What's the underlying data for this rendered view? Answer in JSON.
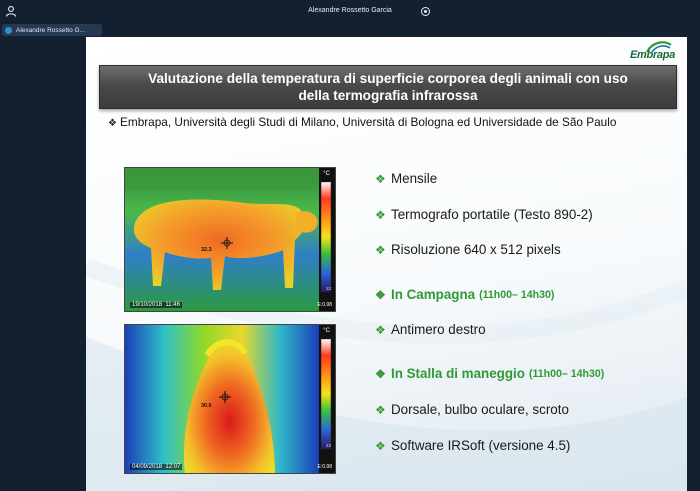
{
  "meeting": {
    "presenter_name": "Alexandre Rossetto Garcia",
    "participant_name": "Alexandre Rossetto G...",
    "icons": {
      "user": "user-icon",
      "record": "record-icon",
      "fullscreen": "fullscreen-icon"
    }
  },
  "slide": {
    "logo": "Embrapa",
    "title_line1": "Valutazione della temperatura di superficie corporea degli animali con uso",
    "title_line2": "della termografia infrarossa",
    "affiliations": "Embrapa, Università degli Studi di Milano, Università di Bologna ed Universidade de São Paulo",
    "images": [
      {
        "unit": "°C",
        "spot_value": "32.3",
        "timestamp": "19/10/2018  11:46",
        "emissivity": "E:0.98",
        "scale_top": "35",
        "scale_bottom": "22"
      },
      {
        "unit": "°C",
        "spot_value": "30.6",
        "timestamp": "04/09/2018  12:07",
        "emissivity": "E:0.98",
        "scale_top": "35",
        "scale_bottom": "22"
      }
    ],
    "features": [
      {
        "text": "Mensile",
        "note": "",
        "highlight": false
      },
      {
        "text": "Termografo portatile (Testo 890-2)",
        "note": "",
        "highlight": false
      },
      {
        "text": "Risoluzione 640 x 512 pixels",
        "note": "",
        "highlight": false
      },
      {
        "text": "In Campagna",
        "note": "(11h00– 14h30)",
        "highlight": true
      },
      {
        "text": "Antimero destro",
        "note": "",
        "highlight": false
      },
      {
        "text": "In Stalla di maneggio",
        "note": "(11h00– 14h30)",
        "highlight": true
      },
      {
        "text": "Dorsale, bulbo oculare, scroto",
        "note": "",
        "highlight": false
      },
      {
        "text": "Software IRSoft (versione 4.5)",
        "note": "",
        "highlight": false
      }
    ],
    "colors": {
      "title_bg": "#4a4a4a",
      "highlight_green": "#2f9a35",
      "bullet_green": "#3a9a3a"
    }
  }
}
